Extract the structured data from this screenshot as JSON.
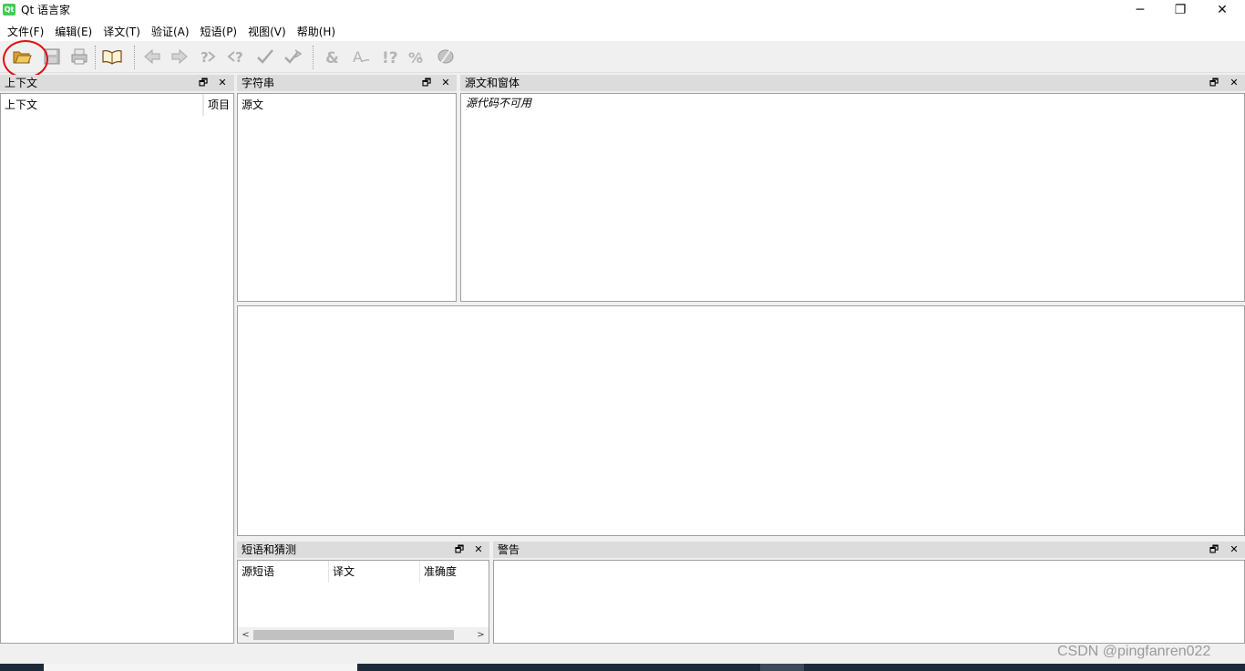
{
  "window": {
    "title": "Qt 语言家",
    "app_icon_text": "Qt",
    "controls": {
      "minimize": "─",
      "maximize": "❐",
      "close": "✕"
    }
  },
  "menu": [
    "文件(F)",
    "编辑(E)",
    "译文(T)",
    "验证(A)",
    "短语(P)",
    "视图(V)",
    "帮助(H)"
  ],
  "toolbar": {
    "icons": [
      "open-icon",
      "save-icon",
      "print-icon",
      "phrasebook-icon",
      "prev-icon",
      "next-icon",
      "prev-unfinished-icon",
      "next-unfinished-icon",
      "done-next-icon",
      "done-icon",
      "accelerator-validation-icon",
      "punctuation-validation-icon",
      "phrase-validation-icon",
      "placemarker-validation-icon",
      "surrounding-whitespace-icon"
    ]
  },
  "dock_float_icon": "🗗",
  "dock_close_icon": "✕",
  "context_panel": {
    "title": "上下文",
    "columns": [
      "上下文",
      "项目"
    ]
  },
  "strings_panel": {
    "title": "字符串",
    "columns": [
      "源文"
    ]
  },
  "source_panel": {
    "title": "源文和窗体",
    "message": "源代码不可用"
  },
  "phrases_panel": {
    "title": "短语和猜测",
    "columns": [
      "源短语",
      "译文",
      "准确度"
    ],
    "scroll_left": "<",
    "scroll_right": ">"
  },
  "warnings_panel": {
    "title": "警告"
  },
  "watermark": "CSDN @pingfanren022",
  "colors": {
    "highlight": "#e01010",
    "folder": "#e8b84a"
  }
}
